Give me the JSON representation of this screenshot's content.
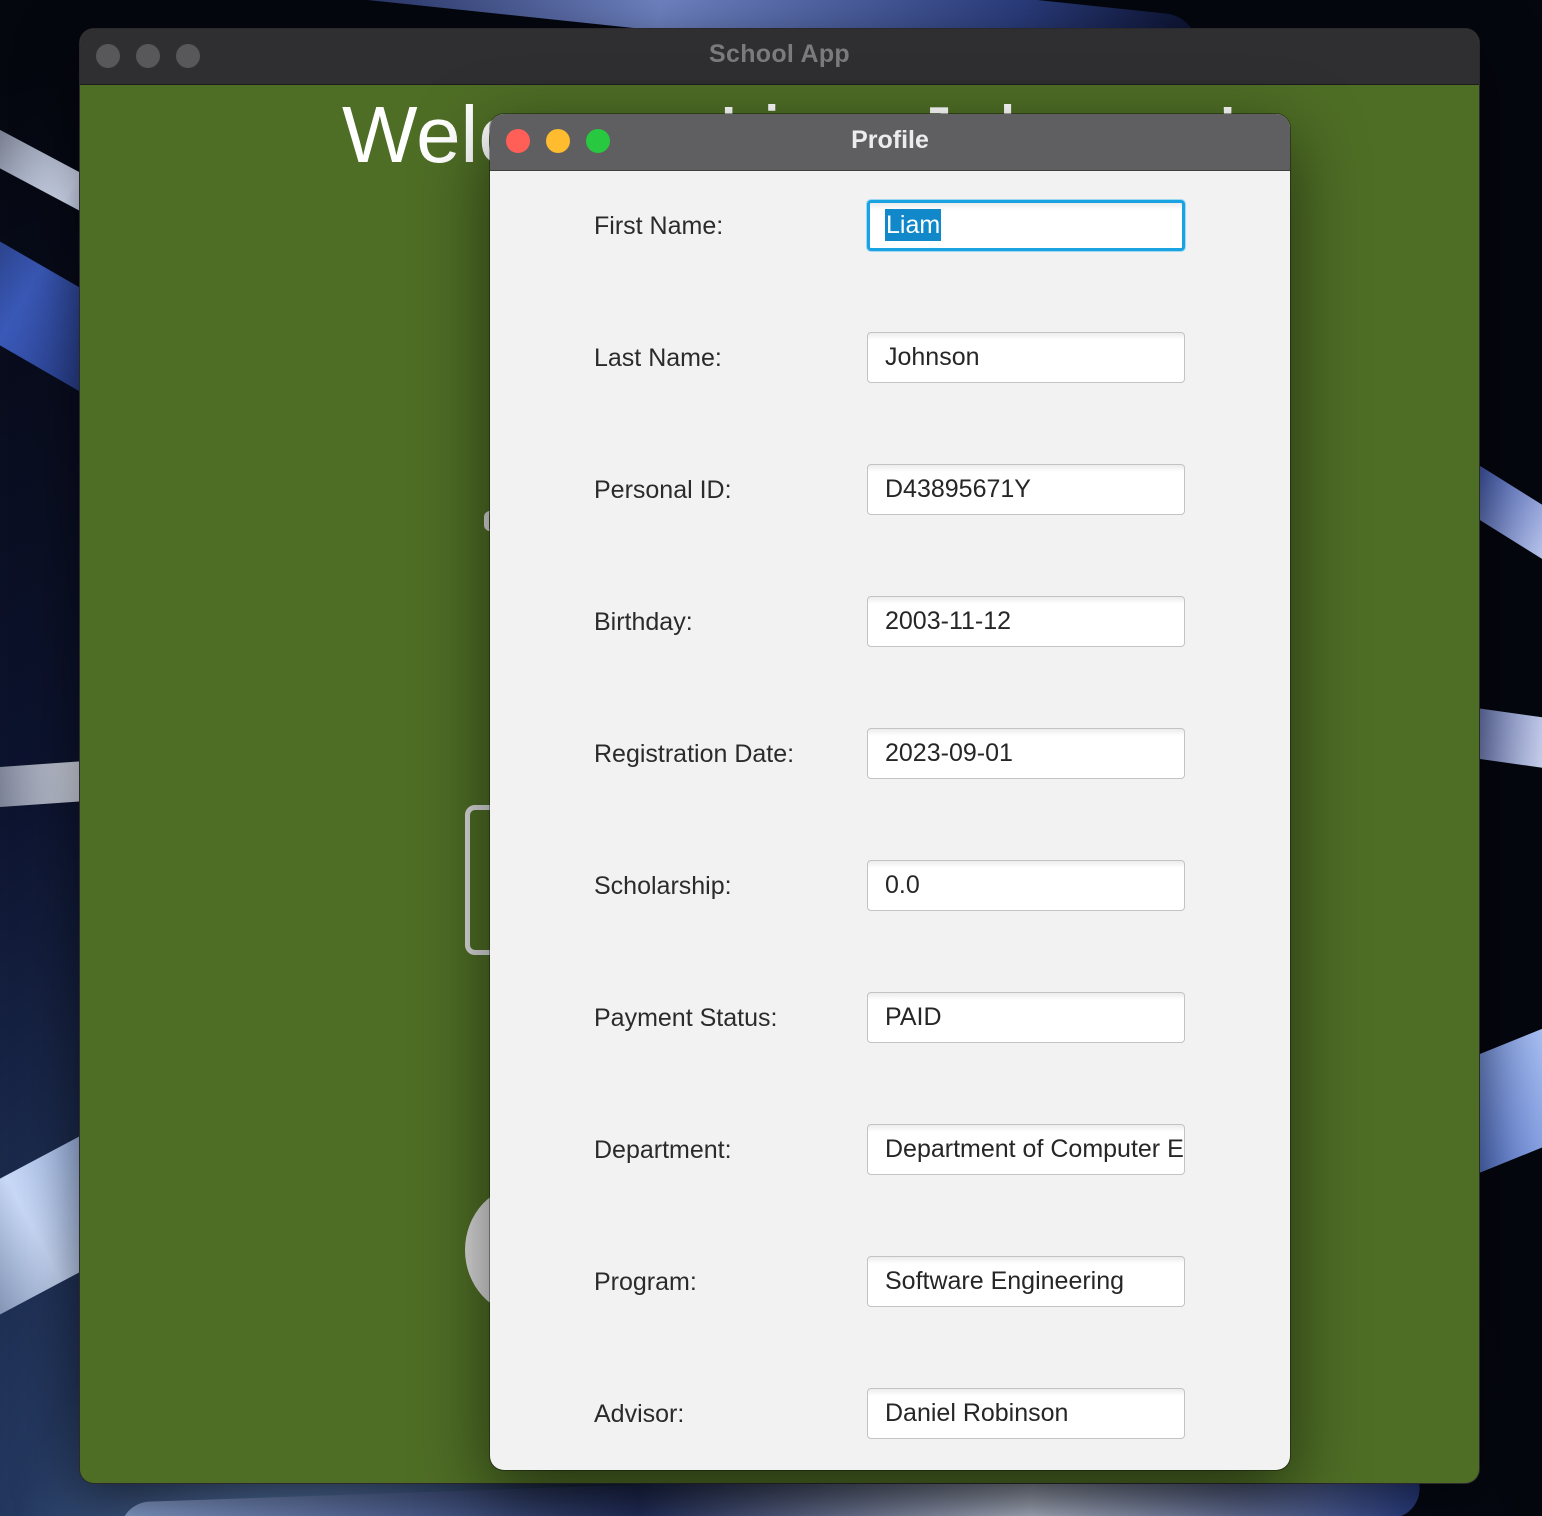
{
  "main_window": {
    "title": "School App",
    "welcome_text": "Welcome, Liam Johnson!"
  },
  "profile_dialog": {
    "title": "Profile",
    "fields": [
      {
        "label": "First Name:",
        "value": "Liam"
      },
      {
        "label": "Last Name:",
        "value": "Johnson"
      },
      {
        "label": "Personal ID:",
        "value": "D43895671Y"
      },
      {
        "label": "Birthday:",
        "value": "2003-11-12"
      },
      {
        "label": "Registration Date:",
        "value": "2023-09-01"
      },
      {
        "label": "Scholarship:",
        "value": "0.0"
      },
      {
        "label": "Payment Status:",
        "value": "PAID"
      },
      {
        "label": "Department:",
        "value": "Department of Computer E"
      },
      {
        "label": "Program:",
        "value": "Software Engineering"
      },
      {
        "label": "Advisor:",
        "value": "Daniel Robinson"
      }
    ]
  },
  "colors": {
    "main_background": "#4e6d25",
    "focus_ring": "#1aa3e0",
    "selection": "#1188c9",
    "close_button": "#ff5f57",
    "minimize_button": "#febc2e",
    "maximize_button": "#28c840"
  }
}
